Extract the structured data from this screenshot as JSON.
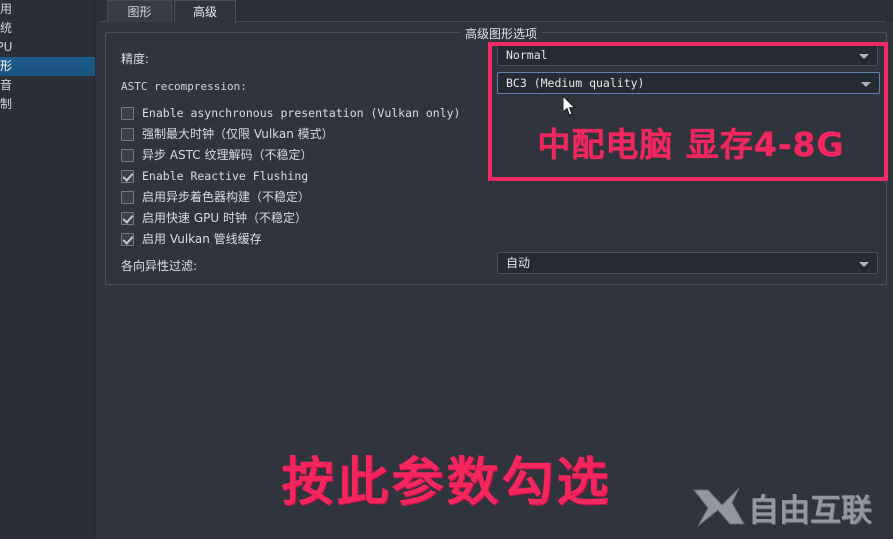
{
  "window": {
    "background_color": "#2b3038",
    "panel_color": "#30353d"
  },
  "sidebar": {
    "items": [
      {
        "label": "通用",
        "selected": false
      },
      {
        "label": "系统",
        "selected": false
      },
      {
        "label": "CPU",
        "selected": false
      },
      {
        "label": "图形",
        "selected": true
      },
      {
        "label": "声音",
        "selected": false
      },
      {
        "label": "控制",
        "selected": false
      }
    ],
    "selected_color": "#1d5c8c"
  },
  "tabs": [
    {
      "label": "图形",
      "active": false
    },
    {
      "label": "高级",
      "active": true
    }
  ],
  "groupbox": {
    "title": "高级图形选项"
  },
  "fields": {
    "accuracy_label": "精度:",
    "accuracy_value": "Normal",
    "astc_label": "ASTC recompression:",
    "astc_value": "BC3 (Medium quality)",
    "aniso_label": "各向异性过滤:",
    "aniso_value": "自动"
  },
  "checkboxes": [
    {
      "label": "Enable asynchronous presentation (Vulkan only)",
      "checked": false,
      "cjk": false
    },
    {
      "label": "强制最大时钟（仅限 Vulkan 模式）",
      "checked": false,
      "cjk": true
    },
    {
      "label": "异步 ASTC 纹理解码（不稳定）",
      "checked": false,
      "cjk": true
    },
    {
      "label": "Enable Reactive Flushing",
      "checked": true,
      "cjk": false
    },
    {
      "label": "启用异步着色器构建（不稳定）",
      "checked": false,
      "cjk": true
    },
    {
      "label": "启用快速 GPU 时钟（不稳定）",
      "checked": true,
      "cjk": true
    },
    {
      "label": "启用 Vulkan 管线缓存",
      "checked": true,
      "cjk": true
    }
  ],
  "annotations": {
    "highlight_color": "#ef2a64",
    "box_text": "中配电脑  显存4-8G",
    "bottom_text": "按此参数勾选"
  },
  "watermark": {
    "mark": "X",
    "text": "自由互联"
  }
}
